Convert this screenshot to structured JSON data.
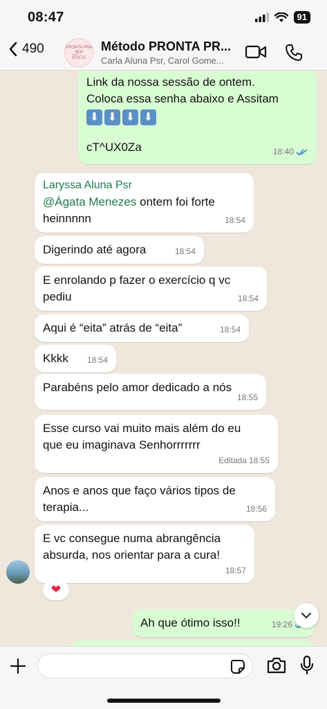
{
  "status": {
    "time": "08:47",
    "battery": "91"
  },
  "header": {
    "back_count": "490",
    "avatar_text": "PRONTA PRA SER",
    "avatar_script": "Rica",
    "title": "Método PRONTA PR...",
    "subtitle": "Carla Aluna Psr, Carol Gome..."
  },
  "messages": {
    "m1": {
      "line1": "Link da nossa sessão de ontem.",
      "line2": "Coloca essa senha abaixo e Assitam",
      "arrows": [
        "⬇",
        "⬇",
        "⬇",
        "⬇"
      ],
      "password": "cT^UX0Za",
      "time": "18:40"
    },
    "m2": {
      "sender": "Laryssa Aluna Psr",
      "mention": "@Ágata Menezes",
      "text_after_mention": " ontem foi forte",
      "line2": "heinnnnn",
      "time": "18:54"
    },
    "m3": {
      "text": "Digerindo até agora",
      "time": "18:54"
    },
    "m4": {
      "line1": "E enrolando p fazer o exercício q vc",
      "line2": "pediu",
      "time": "18:54"
    },
    "m5": {
      "text": "Aqui é “eita” atrás de “eita”",
      "time": "18:54"
    },
    "m6": {
      "text": "Kkkk",
      "time": "18:54"
    },
    "m7": {
      "text": "Parabéns pelo amor dedicado a nós",
      "time": "18:55"
    },
    "m8": {
      "line1": "Esse curso vai muito mais além do eu",
      "line2": "que eu imaginava Senhorrrrrrr",
      "edited": "Editada",
      "time": "18:55"
    },
    "m9": {
      "line1": "Anos e anos que faço vários tipos de",
      "line2": "terapia...",
      "time": "18:56"
    },
    "m10": {
      "line1": "E vc consegue numa abrangência",
      "line2": "absurda, nos orientar para a cura!",
      "time": "18:57",
      "reaction": "❤"
    },
    "m11": {
      "text": "Ah que ótimo isso!!",
      "time": "19:26"
    }
  },
  "colors": {
    "outgoing_bubble": "#d9fdd3",
    "incoming_bubble": "#ffffff",
    "sender_name": "#1f7a4d",
    "read_ticks": "#3b82c4",
    "background": "#efe7dc"
  },
  "icons": [
    "back-chevron-icon",
    "video-call-icon",
    "phone-icon",
    "plus-icon",
    "sticker-icon",
    "camera-icon",
    "microphone-icon",
    "chevron-down-icon"
  ]
}
